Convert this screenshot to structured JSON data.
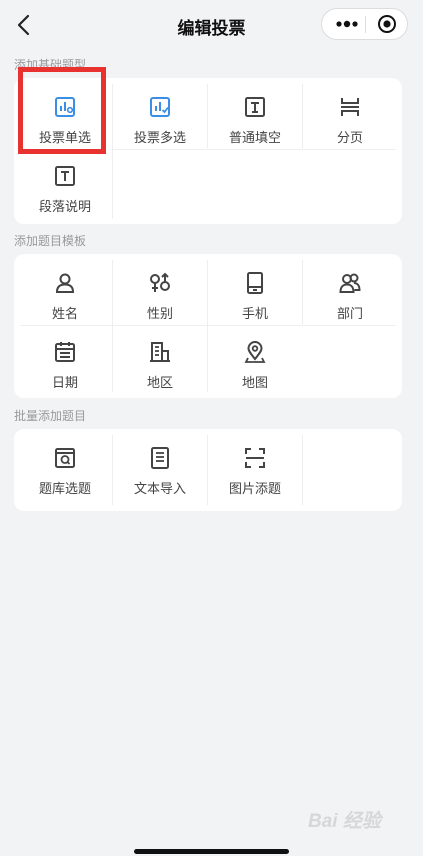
{
  "nav": {
    "title": "编辑投票",
    "back_icon": "chevron-left-icon",
    "more_icon": "more-dots-icon",
    "target_icon": "target-circle-icon"
  },
  "sections": [
    {
      "label": "添加基础题型",
      "items": [
        {
          "label": "投票单选",
          "icon": "chart-single-icon",
          "color": "#3a8ee6"
        },
        {
          "label": "投票多选",
          "icon": "chart-multi-icon",
          "color": "#3a8ee6"
        },
        {
          "label": "普通填空",
          "icon": "text-input-icon",
          "color": "#444444"
        },
        {
          "label": "分页",
          "icon": "page-break-icon",
          "color": "#444444"
        },
        {
          "label": "段落说明",
          "icon": "paragraph-icon",
          "color": "#444444"
        }
      ]
    },
    {
      "label": "添加题目模板",
      "items": [
        {
          "label": "姓名",
          "icon": "person-icon"
        },
        {
          "label": "性别",
          "icon": "gender-icon"
        },
        {
          "label": "手机",
          "icon": "phone-icon"
        },
        {
          "label": "部门",
          "icon": "group-icon"
        },
        {
          "label": "日期",
          "icon": "calendar-icon"
        },
        {
          "label": "地区",
          "icon": "building-icon"
        },
        {
          "label": "地图",
          "icon": "map-pin-icon"
        }
      ]
    },
    {
      "label": "批量添加题目",
      "items": [
        {
          "label": "题库选题",
          "icon": "question-bank-icon"
        },
        {
          "label": "文本导入",
          "icon": "document-icon"
        },
        {
          "label": "图片添题",
          "icon": "scan-icon"
        }
      ]
    }
  ],
  "watermark": "Bai 经验",
  "highlight_color": "#e8322f"
}
